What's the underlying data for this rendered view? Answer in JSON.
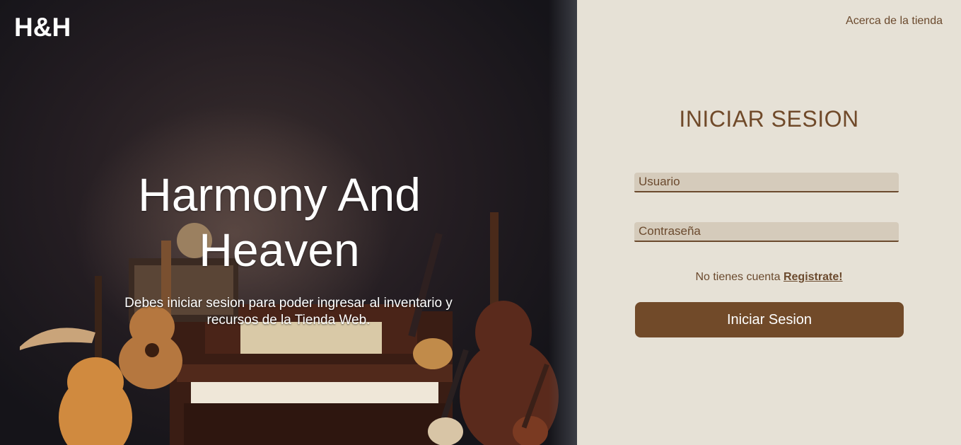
{
  "brand": {
    "logo": "H&H"
  },
  "hero": {
    "title": "Harmony And Heaven",
    "subtitle": "Debes iniciar sesion para poder ingresar al inventario y recursos de la Tienda Web."
  },
  "nav": {
    "about_label": "Acerca de la tienda"
  },
  "login": {
    "title": "INICIAR SESION",
    "username_placeholder": "Usuario",
    "password_placeholder": "Contraseña",
    "no_account_text": "No tienes cuenta",
    "register_label": "Registrate!",
    "submit_label": "Iniciar Sesion"
  },
  "colors": {
    "panel_bg": "#e6e1d6",
    "accent_brown": "#714a29",
    "field_bg": "#d5cbbb",
    "text_brown": "#6b4a2e"
  }
}
